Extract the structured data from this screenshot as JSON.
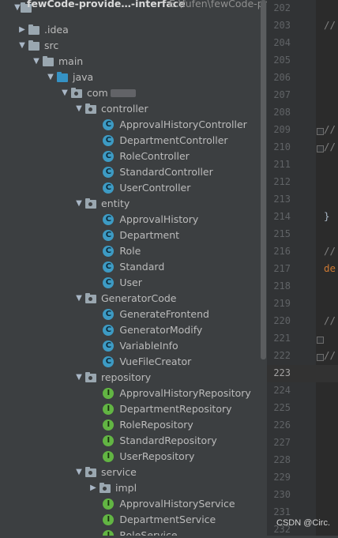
{
  "project": {
    "name": "fewCode-provide…-interface",
    "path": "E:\\fufen\\fewCode-pro"
  },
  "tree": [
    {
      "id": "idea",
      "label": ".idea",
      "arrow": "right",
      "icon": "folder",
      "name": "tree-item-idea"
    },
    {
      "id": "src",
      "label": "src",
      "arrow": "down",
      "icon": "folder",
      "name": "tree-item-src"
    },
    {
      "id": "main",
      "label": "main",
      "arrow": "down",
      "icon": "folder",
      "name": "tree-item-main"
    },
    {
      "id": "java",
      "label": "java",
      "arrow": "down",
      "icon": "folder-blue",
      "name": "tree-item-java"
    },
    {
      "id": "com",
      "label": "com",
      "arrow": "down",
      "icon": "package",
      "name": "tree-item-com"
    },
    {
      "id": "controller",
      "label": "controller",
      "arrow": "down",
      "icon": "package",
      "name": "tree-item-controller"
    },
    {
      "id": "c1",
      "label": "ApprovalHistoryController",
      "icon": "class",
      "name": "tree-item-approvalhistorycontroller"
    },
    {
      "id": "c2",
      "label": "DepartmentController",
      "icon": "class",
      "name": "tree-item-departmentcontroller"
    },
    {
      "id": "c3",
      "label": "RoleController",
      "icon": "class",
      "name": "tree-item-rolecontroller"
    },
    {
      "id": "c4",
      "label": "StandardController",
      "icon": "class",
      "name": "tree-item-standardcontroller"
    },
    {
      "id": "c5",
      "label": "UserController",
      "icon": "class",
      "name": "tree-item-usercontroller"
    },
    {
      "id": "entity",
      "label": "entity",
      "arrow": "down",
      "icon": "package",
      "name": "tree-item-entity"
    },
    {
      "id": "e1",
      "label": "ApprovalHistory",
      "icon": "class",
      "name": "tree-item-approvalhistory"
    },
    {
      "id": "e2",
      "label": "Department",
      "icon": "class",
      "name": "tree-item-department"
    },
    {
      "id": "e3",
      "label": "Role",
      "icon": "class",
      "name": "tree-item-role"
    },
    {
      "id": "e4",
      "label": "Standard",
      "icon": "class",
      "name": "tree-item-standard"
    },
    {
      "id": "e5",
      "label": "User",
      "icon": "class",
      "name": "tree-item-user"
    },
    {
      "id": "gen",
      "label": "GeneratorCode",
      "arrow": "down",
      "icon": "package",
      "name": "tree-item-generatorcode"
    },
    {
      "id": "g1",
      "label": "GenerateFrontend",
      "icon": "class",
      "name": "tree-item-generatefrontend"
    },
    {
      "id": "g2",
      "label": "GeneratorModify",
      "icon": "class",
      "name": "tree-item-generatormodify"
    },
    {
      "id": "g3",
      "label": "VariableInfo",
      "icon": "class",
      "name": "tree-item-variableinfo"
    },
    {
      "id": "g4",
      "label": "VueFileCreator",
      "icon": "class",
      "name": "tree-item-vuefilecreator"
    },
    {
      "id": "repo",
      "label": "repository",
      "arrow": "down",
      "icon": "package",
      "name": "tree-item-repository"
    },
    {
      "id": "r1",
      "label": "ApprovalHistoryRepository",
      "icon": "interface",
      "name": "tree-item-approvalhistoryrepository"
    },
    {
      "id": "r2",
      "label": "DepartmentRepository",
      "icon": "interface",
      "name": "tree-item-departmentrepository"
    },
    {
      "id": "r3",
      "label": "RoleRepository",
      "icon": "interface",
      "name": "tree-item-rolerepository"
    },
    {
      "id": "r4",
      "label": "StandardRepository",
      "icon": "interface",
      "name": "tree-item-standardrepository"
    },
    {
      "id": "r5",
      "label": "UserRepository",
      "icon": "interface",
      "name": "tree-item-userrepository"
    },
    {
      "id": "svc",
      "label": "service",
      "arrow": "down",
      "icon": "package",
      "name": "tree-item-service"
    },
    {
      "id": "impl",
      "label": "impl",
      "arrow": "right",
      "icon": "package",
      "name": "tree-item-impl"
    },
    {
      "id": "s1",
      "label": "ApprovalHistoryService",
      "icon": "interface",
      "name": "tree-item-approvalhistoryservice"
    },
    {
      "id": "s2",
      "label": "DepartmentService",
      "icon": "interface",
      "name": "tree-item-departmentservice"
    },
    {
      "id": "s3",
      "label": "RoleService",
      "icon": "interface",
      "name": "tree-item-roleservice"
    }
  ],
  "icon_letters": {
    "class": "C",
    "interface": "I"
  },
  "editor": {
    "line_numbers": [
      "202",
      "203",
      "204",
      "205",
      "206",
      "207",
      "208",
      "209",
      "210",
      "211",
      "212",
      "213",
      "214",
      "215",
      "216",
      "217",
      "218",
      "219",
      "220",
      "221",
      "222",
      "223",
      "224",
      "225",
      "226",
      "227",
      "228",
      "229",
      "230",
      "231",
      "232"
    ],
    "current_line": "223",
    "code": {
      "203": "//",
      "209": "//",
      "210": "//",
      "214": "}",
      "216": "//",
      "217": "de",
      "220": "//",
      "222": "//"
    }
  },
  "watermark": "CSDN @Circ."
}
